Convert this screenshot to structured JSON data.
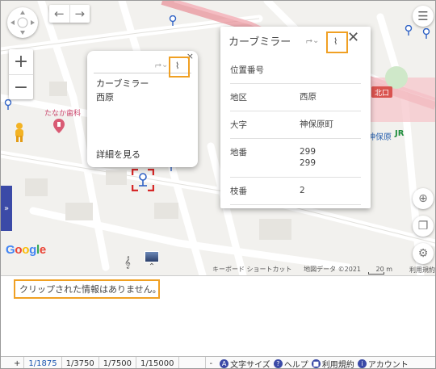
{
  "map": {
    "nav": {
      "back_icon": "arrow-left-icon",
      "forward_icon": "arrow-right-icon"
    },
    "zoom": {
      "in_label": "+",
      "out_label": "−"
    },
    "side_tab_label": "»",
    "labels": {
      "dental": "たなか歯科",
      "north_exit": "北口",
      "station": "神保原",
      "jr": "JR"
    },
    "google_logo": [
      "G",
      "o",
      "o",
      "g",
      "l",
      "e"
    ],
    "footer": {
      "shortcuts": "キーボード ショートカット",
      "map_data": "地図データ ©2021",
      "scale": "20 m",
      "terms": "利用規約"
    }
  },
  "mini_popup": {
    "close": "×",
    "title": "カーブミラー",
    "subtitle": "西原",
    "more_link": "詳細を見る"
  },
  "detail_panel": {
    "title": "カーブミラー",
    "rows": [
      {
        "key": "位置番号",
        "values": [
          ""
        ]
      },
      {
        "key": "地区",
        "values": [
          "西原"
        ]
      },
      {
        "key": "大字",
        "values": [
          "神保原町"
        ]
      },
      {
        "key": "地番",
        "values": [
          "299",
          "299"
        ]
      },
      {
        "key": "枝番",
        "values": [
          "2"
        ]
      }
    ]
  },
  "info": {
    "message": "クリップされた情報はありません。"
  },
  "status_bar": {
    "plus": "+",
    "scales": [
      "1/1875",
      "1/3750",
      "1/7500",
      "1/15000"
    ],
    "active_scale_index": 0,
    "minus": "-",
    "links": [
      {
        "icon": "A",
        "label": "文字サイズ"
      },
      {
        "icon": "?",
        "label": "ヘルプ"
      },
      {
        "icon": "■",
        "label": "利用規約"
      },
      {
        "icon": "i",
        "label": "アカウント"
      }
    ]
  },
  "colors": {
    "accent": "#3b4aa7",
    "highlight": "#f0a023",
    "marker": "#d62828",
    "pin": "#2f62c5"
  }
}
